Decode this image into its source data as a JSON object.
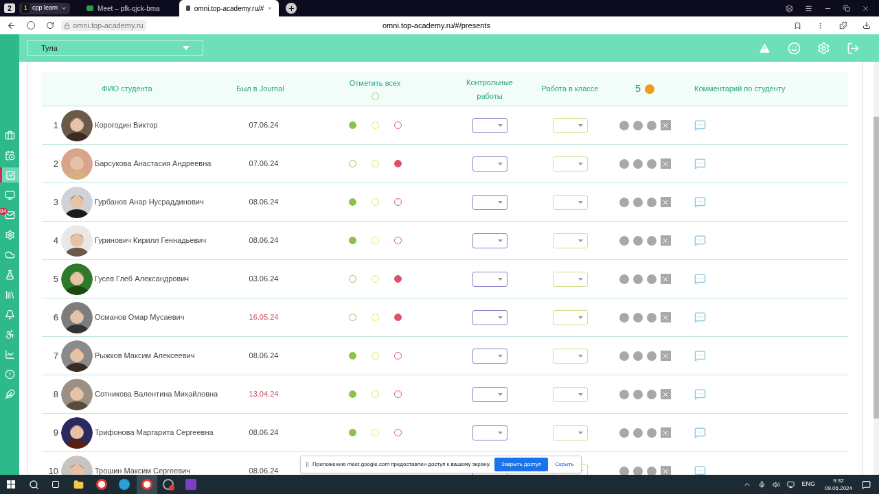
{
  "browser": {
    "workspace": "2",
    "group": {
      "count": "1",
      "label": "cpp learn"
    },
    "tabs": [
      {
        "title": "Meet – pfk-qjck-bma",
        "selected": false
      },
      {
        "title": "omni.top-academy.ru/#",
        "selected": true
      }
    ],
    "address": "omni.top-academy.ru",
    "page_title": "omni.top-academy.ru/#/presents"
  },
  "header": {
    "city": "Тула"
  },
  "sidebar": {
    "items": [
      {
        "selected": false
      },
      {
        "selected": false
      },
      {
        "selected": true
      },
      {
        "selected": false
      },
      {
        "selected": false,
        "badge": "84"
      },
      {
        "selected": false
      },
      {
        "selected": false
      },
      {
        "selected": false
      },
      {
        "selected": false
      },
      {
        "selected": false
      },
      {
        "selected": false
      },
      {
        "selected": false
      },
      {
        "selected": false
      },
      {
        "selected": false
      }
    ]
  },
  "table": {
    "mark_all_selected": false,
    "columns": {
      "name": "ФИО студента",
      "journal": "Был в Journal",
      "mark_all": "Отметить всех",
      "tests": "Контрольные работы",
      "classwork": "Работа в классе",
      "coins": "5",
      "comment": "Комментарий по студенту"
    },
    "rows": [
      {
        "num": "1",
        "name": "Корогодин Виктор",
        "date": "07.06.24",
        "overdue": false,
        "attendance": [
          {
            "selected": true
          },
          {
            "selected": false
          },
          {
            "selected": false
          }
        ]
      },
      {
        "num": "2",
        "name": "Барсукова Анастасия Андреевна",
        "date": "07.06.24",
        "overdue": false,
        "attendance": [
          {
            "selected": false
          },
          {
            "selected": false
          },
          {
            "selected": true
          }
        ]
      },
      {
        "num": "3",
        "name": "Гурбанов Анар Нусраддинович",
        "date": "08.06.24",
        "overdue": false,
        "attendance": [
          {
            "selected": true
          },
          {
            "selected": false
          },
          {
            "selected": false
          }
        ]
      },
      {
        "num": "4",
        "name": "Гуринович Кирилл Геннадьевич",
        "date": "08.06.24",
        "overdue": false,
        "attendance": [
          {
            "selected": true
          },
          {
            "selected": false
          },
          {
            "selected": false
          }
        ]
      },
      {
        "num": "5",
        "name": "Гусев Глеб Александрович",
        "date": "03.06.24",
        "overdue": false,
        "attendance": [
          {
            "selected": false
          },
          {
            "selected": false
          },
          {
            "selected": true
          }
        ]
      },
      {
        "num": "6",
        "name": "Османов Омар Мусаевич",
        "date": "16.05.24",
        "overdue": true,
        "attendance": [
          {
            "selected": false
          },
          {
            "selected": false
          },
          {
            "selected": true
          }
        ]
      },
      {
        "num": "7",
        "name": "Рыжков Максим Алексеевич",
        "date": "08.06.24",
        "overdue": false,
        "attendance": [
          {
            "selected": true
          },
          {
            "selected": false
          },
          {
            "selected": false
          }
        ]
      },
      {
        "num": "8",
        "name": "Сотникова Валентина Михайловна",
        "date": "13.04.24",
        "overdue": true,
        "attendance": [
          {
            "selected": true
          },
          {
            "selected": false
          },
          {
            "selected": false
          }
        ]
      },
      {
        "num": "9",
        "name": "Трифонова Маргарита Сергеевна",
        "date": "08.06.24",
        "overdue": false,
        "attendance": [
          {
            "selected": true
          },
          {
            "selected": false
          },
          {
            "selected": false
          }
        ]
      },
      {
        "num": "10",
        "name": "Трошин Максим Сергеевич",
        "date": "08.06.24",
        "overdue": false
      }
    ]
  },
  "share_bar": {
    "text": "Приложению meet.google.com предоставлен доступ к вашему экрану.",
    "stop": "Закрыть доступ",
    "hide": "Скрыть"
  },
  "taskbar": {
    "language": "ENG",
    "time": "9:32",
    "date": "09.06.2024"
  }
}
